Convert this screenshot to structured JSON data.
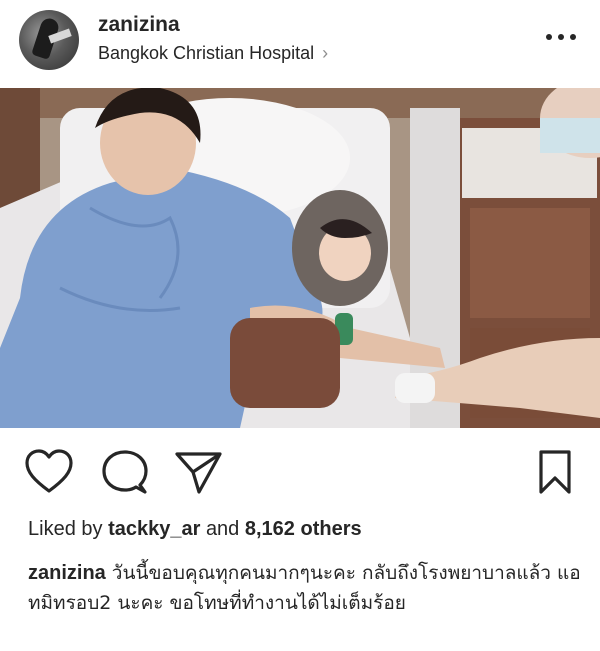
{
  "post": {
    "username": "zanizina",
    "location": "Bangkok Christian Hospital",
    "location_chevron": "›"
  },
  "icons": {
    "more": "more-options-icon",
    "like": "heart-icon",
    "comment": "comment-icon",
    "share": "send-icon",
    "save": "bookmark-icon"
  },
  "likes": {
    "prefix": "Liked by",
    "user": "tackky_ar",
    "connector": "and",
    "others": "8,162 others"
  },
  "caption": {
    "username": "zanizina",
    "text": "วันนี้ขอบคุณทุกคนมากๆนะคะ กลับถึงโรงพยาบาลแล้ว แอทมิทรอบ2 นะคะ ขอโทษที่ทำงานได้ไม่เต็มร้อย"
  },
  "colors": {
    "text": "#262626",
    "muted": "#8e8e8e",
    "gown": "#7f9fce"
  }
}
